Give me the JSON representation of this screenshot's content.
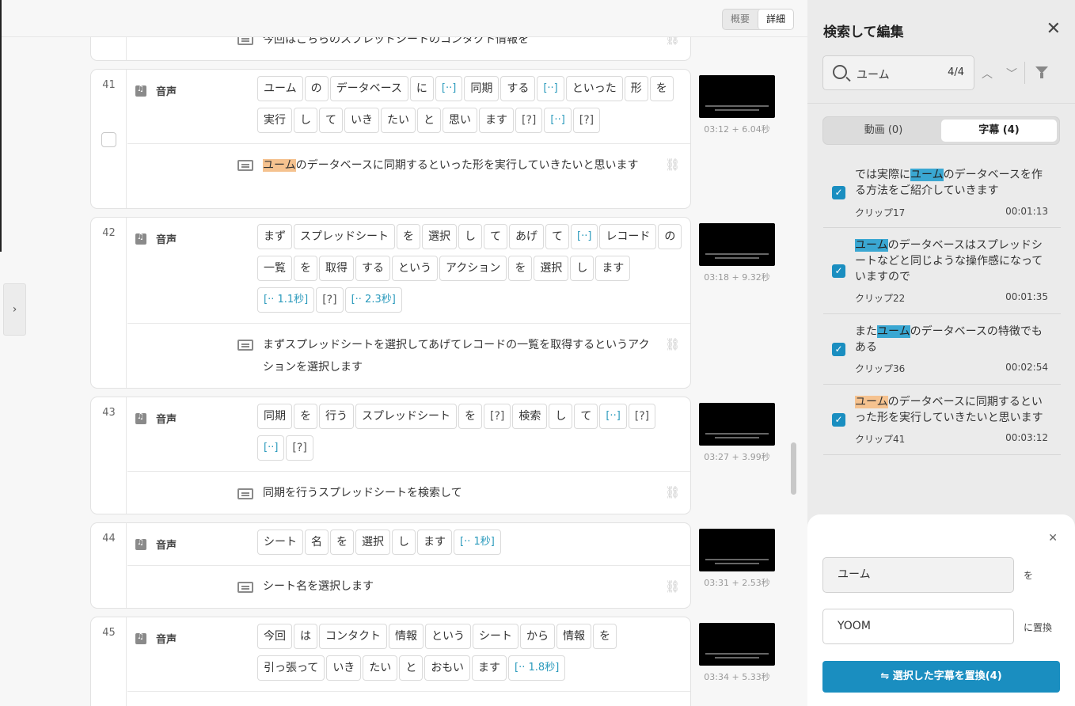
{
  "view_toggle": {
    "summary": "概要",
    "detail": "詳細"
  },
  "voice_label": "音声",
  "clips": [
    {
      "subtitle_cut": "今回はこちらのスプレッドシートのコンタクト情報を"
    },
    {
      "num": "41",
      "time": "03:12 + 6.04秒",
      "subtitle_hl": "ユーム",
      "subtitle_rest": "のデータベースに同期するといった形を実行していきたいと思います"
    },
    {
      "num": "42",
      "time": "03:18 + 9.32秒",
      "subtitle": "まずスプレッドシートを選択してあげてレコードの一覧を取得するというアクションを選択します"
    },
    {
      "num": "43",
      "time": "03:27 + 3.99秒",
      "subtitle": "同期を行うスプレッドシートを検索して"
    },
    {
      "num": "44",
      "time": "03:31 + 2.53秒",
      "subtitle": "シート名を選択します"
    },
    {
      "num": "45",
      "time": "03:34 + 5.33秒"
    }
  ],
  "tokens": {
    "c41": [
      "ユーム",
      "の",
      "データベース",
      "に",
      "[··]",
      "同期",
      "する",
      "[··]",
      "といった",
      "形",
      "を",
      "実行",
      "し",
      "て",
      "いき",
      "たい",
      "と",
      "思い",
      "ます",
      "[?]",
      "[··]",
      "[?]"
    ],
    "c42": [
      "まず",
      "スプレッドシート",
      "を",
      "選択",
      "し",
      "て",
      "あげ",
      "て",
      "[··]",
      "レコード",
      "の",
      "一覧",
      "を",
      "取得",
      "する",
      "という",
      "アクション",
      "を",
      "選択",
      "し",
      "ます",
      "[·· 1.1秒]",
      "[?]",
      "[·· 2.3秒]"
    ],
    "c43": [
      "同期",
      "を",
      "行う",
      "スプレッドシート",
      "を",
      "[?]",
      "検索",
      "し",
      "て",
      "[··]",
      "[?]",
      "[··]",
      "[?]"
    ],
    "c44": [
      "シート",
      "名",
      "を",
      "選択",
      "し",
      "ます",
      "[·· 1秒]"
    ],
    "c45": [
      "今回",
      "は",
      "コンタクト",
      "情報",
      "という",
      "シート",
      "から",
      "情報",
      "を",
      "引っ張って",
      "いき",
      "たい",
      "と",
      "おもい",
      "ます",
      "[·· 1.8秒]"
    ]
  },
  "panel": {
    "title": "検索して編集",
    "search_value": "ユーム",
    "search_count": "4/4",
    "tab_video": "動画 (0)",
    "tab_subtitle": "字幕 (4)"
  },
  "results": [
    {
      "pre": "では実際に",
      "hl": "ユーム",
      "post": "のデータベースを作る方法をご紹介していきます",
      "clip": "クリップ17",
      "time": "00:01:13"
    },
    {
      "pre": "",
      "hl": "ユーム",
      "post": "のデータベースはスプレッドシートなどと同じような操作感になっていますので",
      "clip": "クリップ22",
      "time": "00:01:35"
    },
    {
      "pre": "また",
      "hl": "ユーム",
      "post": "のデータベースの特徴でもある",
      "clip": "クリップ36",
      "time": "00:02:54"
    },
    {
      "pre": "",
      "hl": "ユーム",
      "post": "のデータベースに同期するといった形を実行していきたいと思います",
      "clip": "クリップ41",
      "time": "00:03:12"
    }
  ],
  "replace": {
    "find": "ユーム",
    "find_suffix": "を",
    "with": "YOOM",
    "with_suffix": "に置換",
    "button": "⇋  選択した字幕を置換(4)"
  },
  "colors": {
    "accent": "#1a8ec0",
    "highlight_current": "#f5c28f",
    "highlight_match": "#3aa7d2",
    "pause_token": "#2a9abc"
  }
}
